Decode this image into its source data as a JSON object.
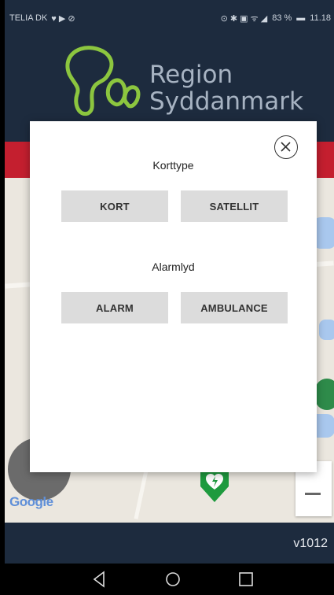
{
  "status_bar": {
    "carrier": "TELIA DK",
    "battery": "83 %",
    "time": "11.18"
  },
  "header": {
    "brand_line1": "Region",
    "brand_line2": "Syddanmark",
    "logo_color": "#8cc63f"
  },
  "map": {
    "google_logo": "Google"
  },
  "footer": {
    "version": "v1012"
  },
  "modal": {
    "map_type_title": "Korttype",
    "map_type_buttons": [
      "KORT",
      "SATELLIT"
    ],
    "alarm_title": "Alarmlyd",
    "alarm_buttons": [
      "ALARM",
      "AMBULANCE"
    ]
  },
  "colors": {
    "header_bg": "#1d2b3e",
    "red_bar": "#c41f2f",
    "marker_green": "#1e9a3e"
  }
}
